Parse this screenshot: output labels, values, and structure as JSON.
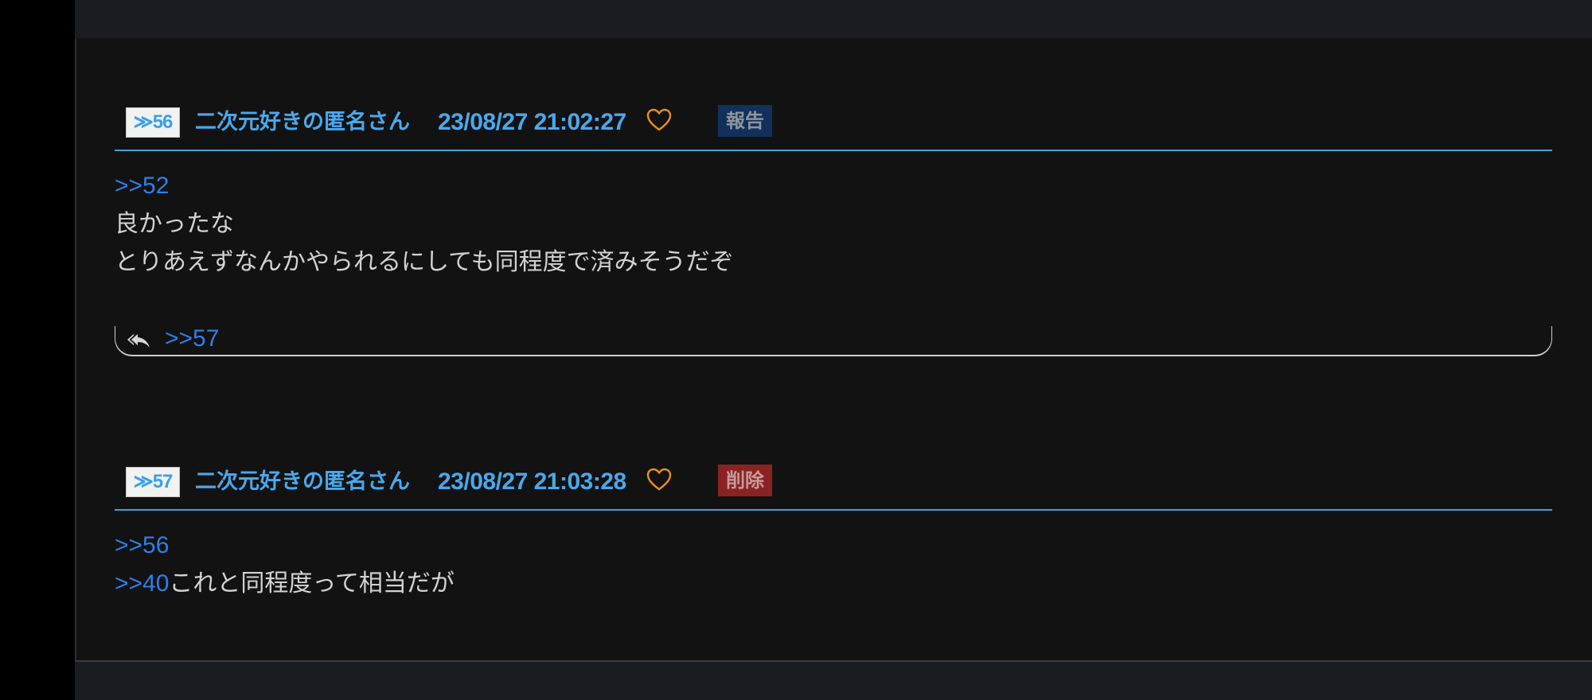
{
  "posts": [
    {
      "number": "≫56",
      "name": "二次元好きの匿名さん",
      "date": "23/08/27 21:02:27",
      "action_label": "報告",
      "lines": [
        {
          "anchor": ">>52",
          "text": ""
        },
        {
          "anchor": "",
          "text": "良かったな"
        },
        {
          "anchor": "",
          "text": "とりあえずなんかやられるにしても同程度で済みそうだぞ"
        }
      ],
      "replies": [
        ">>57"
      ]
    },
    {
      "number": "≫57",
      "name": "二次元好きの匿名さん",
      "date": "23/08/27 21:03:28",
      "action_label": "削除",
      "lines": [
        {
          "anchor": ">>56",
          "text": ""
        },
        {
          "anchor": ">>40",
          "text": "これと同程度って相当だが"
        }
      ]
    }
  ],
  "colors": {
    "accent": "#3aa0e8",
    "link": "#2f7fe6",
    "heart": "#e8901a",
    "report_bg": "#11305a",
    "delete_bg": "#8b2222"
  },
  "icons": {
    "like": "heart-outline-icon",
    "reply": "reply-all-icon"
  }
}
